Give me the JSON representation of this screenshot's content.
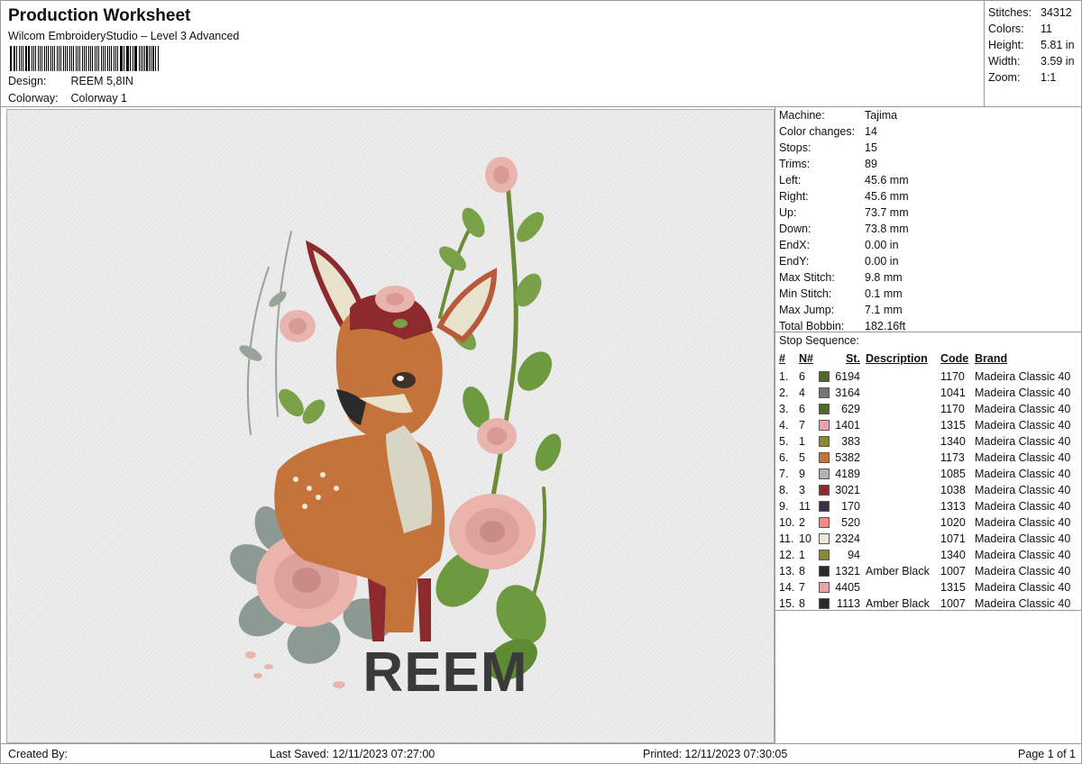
{
  "header": {
    "title": "Production Worksheet",
    "subtitle": "Wilcom EmbroideryStudio – Level 3 Advanced",
    "design_label": "Design:",
    "design_value": "REEM 5,8IN",
    "colorway_label": "Colorway:",
    "colorway_value": "Colorway 1"
  },
  "top_stats": [
    {
      "label": "Stitches:",
      "value": "34312"
    },
    {
      "label": "Colors:",
      "value": "11"
    },
    {
      "label": "Height:",
      "value": "5.81 in"
    },
    {
      "label": "Width:",
      "value": "3.59 in"
    },
    {
      "label": "Zoom:",
      "value": "1:1"
    }
  ],
  "canvas": {
    "design_text": "REEM"
  },
  "machine_info": [
    {
      "label": "Machine:",
      "value": "Tajima"
    },
    {
      "label": "Color changes:",
      "value": "14"
    },
    {
      "label": "Stops:",
      "value": "15"
    },
    {
      "label": "Trims:",
      "value": "89"
    },
    {
      "label": "Left:",
      "value": "45.6 mm"
    },
    {
      "label": "Right:",
      "value": "45.6 mm"
    },
    {
      "label": "Up:",
      "value": "73.7 mm"
    },
    {
      "label": "Down:",
      "value": "73.8 mm"
    },
    {
      "label": "EndX:",
      "value": "0.00 in"
    },
    {
      "label": "EndY:",
      "value": "0.00 in"
    },
    {
      "label": "Max Stitch:",
      "value": "9.8 mm"
    },
    {
      "label": "Min Stitch:",
      "value": "0.1 mm"
    },
    {
      "label": "Max Jump:",
      "value": "7.1 mm"
    },
    {
      "label": "Total Bobbin:",
      "value": "182.16ft"
    }
  ],
  "stop_sequence": {
    "title": "Stop Sequence:",
    "headers": {
      "idx": "#",
      "n": "N#",
      "st": "St.",
      "desc": "Description",
      "code": "Code",
      "brand": "Brand"
    },
    "rows": [
      {
        "idx": "1.",
        "n": "6",
        "color": "#4f6b2c",
        "st": "6194",
        "desc": "",
        "code": "1170",
        "brand": "Madeira Classic 40"
      },
      {
        "idx": "2.",
        "n": "4",
        "color": "#6f777a",
        "st": "3164",
        "desc": "",
        "code": "1041",
        "brand": "Madeira Classic 40"
      },
      {
        "idx": "3.",
        "n": "6",
        "color": "#4f6b2c",
        "st": "629",
        "desc": "",
        "code": "1170",
        "brand": "Madeira Classic 40"
      },
      {
        "idx": "4.",
        "n": "7",
        "color": "#e8a4a8",
        "st": "1401",
        "desc": "",
        "code": "1315",
        "brand": "Madeira Classic 40"
      },
      {
        "idx": "5.",
        "n": "1",
        "color": "#8b8a33",
        "st": "383",
        "desc": "",
        "code": "1340",
        "brand": "Madeira Classic 40"
      },
      {
        "idx": "6.",
        "n": "5",
        "color": "#c4743a",
        "st": "5382",
        "desc": "",
        "code": "1173",
        "brand": "Madeira Classic 40"
      },
      {
        "idx": "7.",
        "n": "9",
        "color": "#b3b3ad",
        "st": "4189",
        "desc": "",
        "code": "1085",
        "brand": "Madeira Classic 40"
      },
      {
        "idx": "8.",
        "n": "3",
        "color": "#8c2a2e",
        "st": "3021",
        "desc": "",
        "code": "1038",
        "brand": "Madeira Classic 40"
      },
      {
        "idx": "9.",
        "n": "11",
        "color": "#3d2f4a",
        "st": "170",
        "desc": "",
        "code": "1313",
        "brand": "Madeira Classic 40"
      },
      {
        "idx": "10.",
        "n": "2",
        "color": "#f08a82",
        "st": "520",
        "desc": "",
        "code": "1020",
        "brand": "Madeira Classic 40"
      },
      {
        "idx": "11.",
        "n": "10",
        "color": "#ede7d3",
        "st": "2324",
        "desc": "",
        "code": "1071",
        "brand": "Madeira Classic 40"
      },
      {
        "idx": "12.",
        "n": "1",
        "color": "#8b8a33",
        "st": "94",
        "desc": "",
        "code": "1340",
        "brand": "Madeira Classic 40"
      },
      {
        "idx": "13.",
        "n": "8",
        "color": "#2a2a2a",
        "st": "1321",
        "desc": "Amber Black",
        "code": "1007",
        "brand": "Madeira Classic 40"
      },
      {
        "idx": "14.",
        "n": "7",
        "color": "#e8a4a8",
        "st": "4405",
        "desc": "",
        "code": "1315",
        "brand": "Madeira Classic 40"
      },
      {
        "idx": "15.",
        "n": "8",
        "color": "#2a2a2a",
        "st": "1113",
        "desc": "Amber Black",
        "code": "1007",
        "brand": "Madeira Classic 40"
      }
    ]
  },
  "footer": {
    "created_by": "Created By:",
    "last_saved": "Last Saved: 12/11/2023 07:27:00",
    "printed": "Printed: 12/11/2023 07:30:05",
    "page": "Page 1 of 1"
  }
}
